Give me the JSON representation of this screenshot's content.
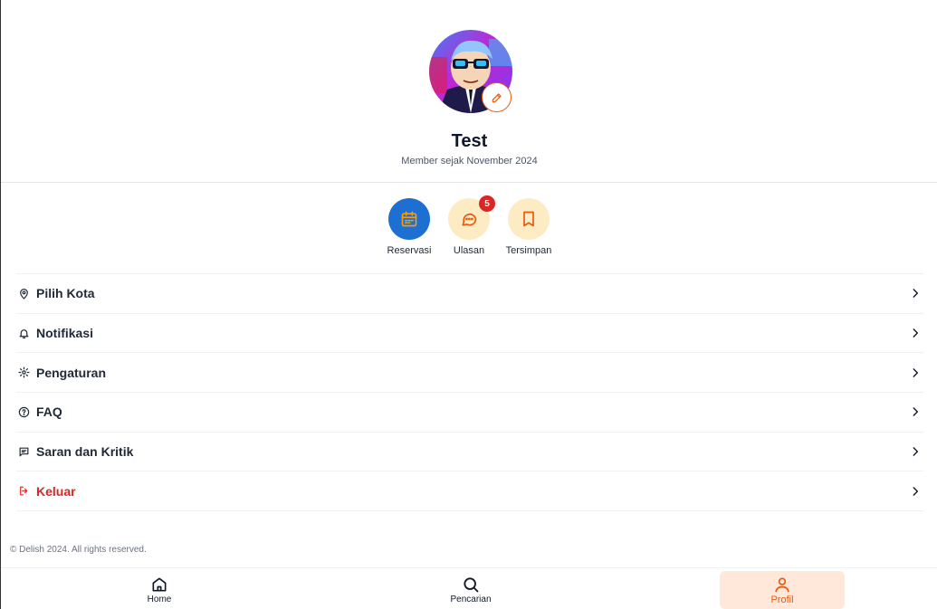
{
  "profile": {
    "name": "Test",
    "member_since": "Member sejak November 2024"
  },
  "quick_actions": [
    {
      "label": "Reservasi",
      "icon": "calendar-icon",
      "bg": "#1d6fd1"
    },
    {
      "label": "Ulasan",
      "icon": "chat-icon",
      "bg": "#fdebc4",
      "badge": "5"
    },
    {
      "label": "Tersimpan",
      "icon": "bookmark-icon",
      "bg": "#fdebc4"
    }
  ],
  "menu": [
    {
      "label": "Pilih Kota",
      "icon": "map-pin-icon"
    },
    {
      "label": "Notifikasi",
      "icon": "bell-icon"
    },
    {
      "label": "Pengaturan",
      "icon": "gear-icon"
    },
    {
      "label": "FAQ",
      "icon": "question-circle-icon"
    },
    {
      "label": "Saran dan Kritik",
      "icon": "message-square-icon"
    },
    {
      "label": "Keluar",
      "icon": "logout-icon"
    }
  ],
  "footer": {
    "copyright": "© Delish 2024. All rights reserved."
  },
  "bottom_nav": [
    {
      "label": "Home",
      "icon": "home-icon"
    },
    {
      "label": "Pencarian",
      "icon": "search-icon"
    },
    {
      "label": "Profil",
      "icon": "user-icon",
      "active": true
    }
  ],
  "colors": {
    "accent": "#ea580c",
    "primary_blue": "#1d6fd1",
    "danger": "#dc2626",
    "soft_yellow": "#fdebc4",
    "active_tab_bg": "#ffe8d9"
  }
}
